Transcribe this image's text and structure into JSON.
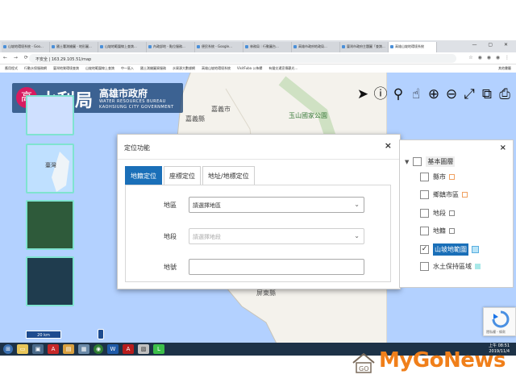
{
  "browser": {
    "tabs": [
      {
        "label": "山坡地環境系統 - Goo..."
      },
      {
        "label": "國土署測繪圖 - 地形圖..."
      },
      {
        "label": "山坡地範圍線上查詢..."
      },
      {
        "label": "內政部地 - 點位服務..."
      },
      {
        "label": "便民系統 - Google..."
      },
      {
        "label": "林務局｜行動圖台..."
      },
      {
        "label": "高雄市政府地政局..."
      },
      {
        "label": "臺灣市政府主題圖「查詢..."
      },
      {
        "label": "高雄山坡地環境系統"
      }
    ],
    "url": "不安全 | 163.29.105.51/map",
    "bookmarks": [
      "應用程式",
      "行動水保服務網",
      "臺灣地質環境查詢",
      "山坡地範圍線上查詢",
      "中一區入",
      "國土測繪圖資服務",
      "水資源大數據網",
      "高雄山坡地環境系統",
      "VisitFuba 公佈欄",
      "有聲交通宣傳觀光...",
      "其他書籤"
    ]
  },
  "header": {
    "logo_char": "高",
    "title": "水利局",
    "subtitle": "高雄市政府",
    "en_line1": "WATER RESOURCES BUREAU",
    "en_line2": "KAOHSIUNG CITY GOVERNMENT"
  },
  "map": {
    "labels": [
      "嘉義市",
      "嘉義縣",
      "玉山國家公園",
      "屏東縣"
    ],
    "thumb_label": "臺灣",
    "scale": "20 km"
  },
  "dialog": {
    "title": "定位功能",
    "close": "×",
    "tabs": [
      {
        "label": "地籍定位",
        "active": true
      },
      {
        "label": "座標定位",
        "active": false
      },
      {
        "label": "地址/地標定位",
        "active": false
      }
    ],
    "fields": {
      "district_label": "地區",
      "district_value": "請選擇地區",
      "section_label": "地段",
      "section_value": "請選擇地段",
      "lot_label": "地號",
      "lot_value": ""
    }
  },
  "layers": {
    "close": "×",
    "root": "基本圖層",
    "items": [
      {
        "label": "縣市",
        "checked": false,
        "color": "#f0a060"
      },
      {
        "label": "鄉鎮市區",
        "checked": false,
        "color": "#f0a060"
      },
      {
        "label": "地段",
        "checked": false,
        "color": "#888888"
      },
      {
        "label": "地籍",
        "checked": false,
        "color": "#888888"
      },
      {
        "label": "山坡地範圍",
        "checked": true,
        "color": "#8fd0f0"
      },
      {
        "label": "水土保持區域",
        "checked": false,
        "color": "#a8e8e8"
      }
    ]
  },
  "recaptcha": {
    "text": "隱私權 - 條款"
  },
  "taskbar": {
    "time": "上午 08:51",
    "date": "2019/11/4"
  },
  "watermark": {
    "brand": "MyGoNews",
    "mark": "GO"
  }
}
